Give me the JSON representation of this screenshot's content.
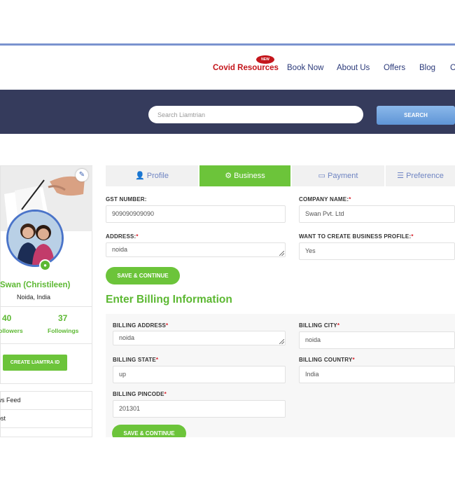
{
  "nav": {
    "covid": "Covid Resources",
    "new_badge": "NEW",
    "book_now": "Book Now",
    "about_us": "About Us",
    "offers": "Offers",
    "blog": "Blog",
    "contact_partial": "C"
  },
  "search": {
    "placeholder": "Search Liamtrian",
    "button": "SEARCH"
  },
  "profile": {
    "name": "Swan (Christileen)",
    "location": "Noida, India",
    "followers_count": "40",
    "followers_label": "Followers",
    "followings_count": "37",
    "followings_label": "Followings",
    "create_button": "CREATE LIAMTRA ID",
    "menu": [
      "News Feed",
      "Post"
    ]
  },
  "tabs": [
    {
      "label": "Profile",
      "icon": "user-gear-icon"
    },
    {
      "label": "Business",
      "icon": "gear-icon"
    },
    {
      "label": "Payment",
      "icon": "credit-card-icon"
    },
    {
      "label": "Preference",
      "icon": "sliders-icon"
    }
  ],
  "business": {
    "gst_label": "GST NUMBER:",
    "gst_value": "909090909090",
    "company_label": "COMPANY NAME:",
    "company_value": "Swan Pvt. Ltd",
    "address_label": "ADDRESS:",
    "address_value": "noida",
    "bprofile_label": "WANT TO CREATE BUSINESS PROFILE:",
    "bprofile_value": "Yes",
    "save_button": "SAVE & CONTINUE"
  },
  "billing": {
    "title": "Enter Billing Information",
    "address_label": "BILLING ADDRESS",
    "address_value": "noida",
    "city_label": "BILLING CITY",
    "city_value": "noida",
    "state_label": "BILLING STATE",
    "state_value": "up",
    "country_label": "BILLING COUNTRY",
    "country_value": "India",
    "pincode_label": "BILLING PINCODE",
    "pincode_value": "201301",
    "save_button": "SAVE & CONTINUE"
  },
  "colors": {
    "accent_green": "#6cc43a",
    "navy": "#353b5c",
    "nav_blue": "#2b3a7a",
    "covid_red": "#c4161c"
  }
}
